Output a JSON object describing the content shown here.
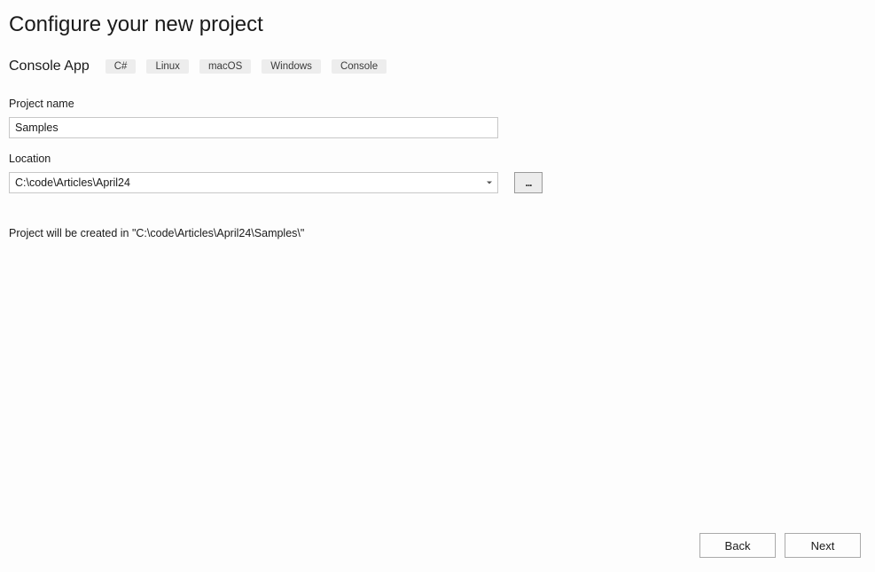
{
  "page": {
    "title": "Configure your new project"
  },
  "template": {
    "name": "Console App",
    "tags": [
      "C#",
      "Linux",
      "macOS",
      "Windows",
      "Console"
    ]
  },
  "fields": {
    "projectName": {
      "label": "Project name",
      "value": "Samples"
    },
    "location": {
      "label": "Location",
      "value": "C:\\code\\Articles\\April24",
      "browseLabel": "..."
    }
  },
  "creationPath": "Project will be created in \"C:\\code\\Articles\\April24\\Samples\\\"",
  "footer": {
    "back": "Back",
    "next": "Next"
  }
}
